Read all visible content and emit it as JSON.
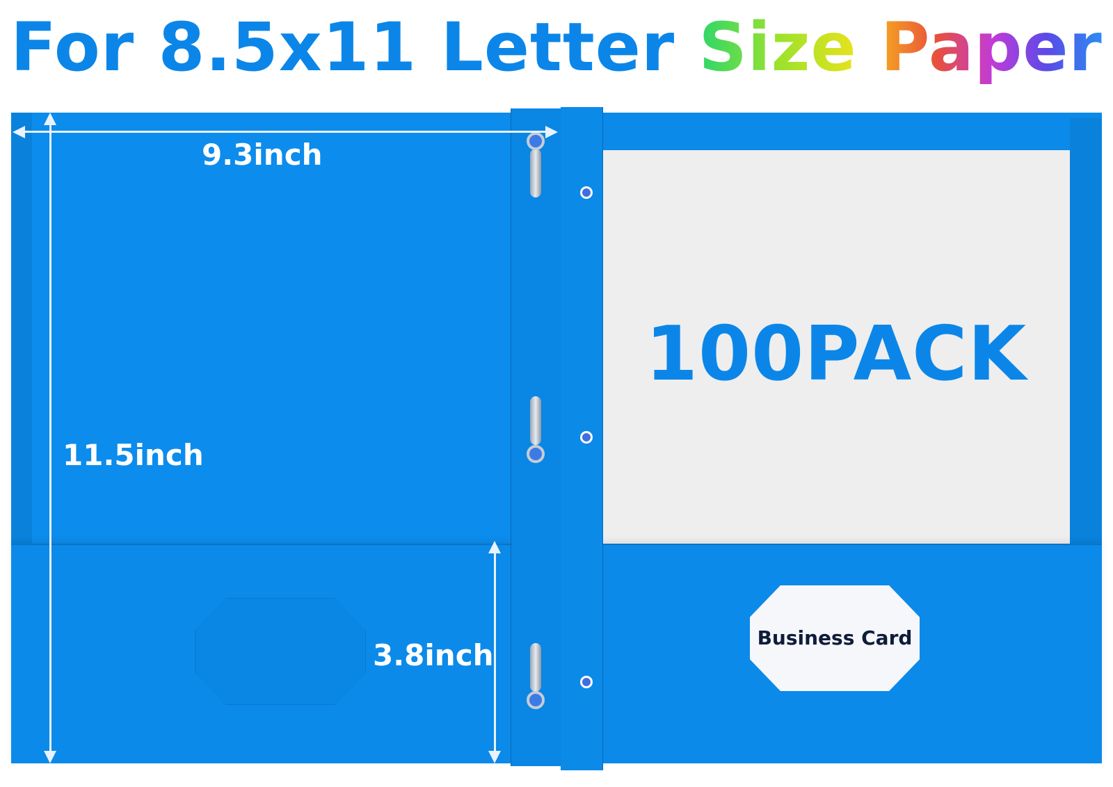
{
  "title": {
    "part1": "For 8.5x11 Letter ",
    "part2": "Size",
    "part3": " ",
    "part4": "Paper"
  },
  "dimensions": {
    "width": "9.3inch",
    "height": "11.5inch",
    "pocket_height": "3.8inch"
  },
  "pack_label": "100PACK",
  "card_slot_label": "Business Card",
  "colors": {
    "folder_blue": "#0a8aea",
    "title_blue": "#0b86e8",
    "paper": "#eeeeee"
  }
}
